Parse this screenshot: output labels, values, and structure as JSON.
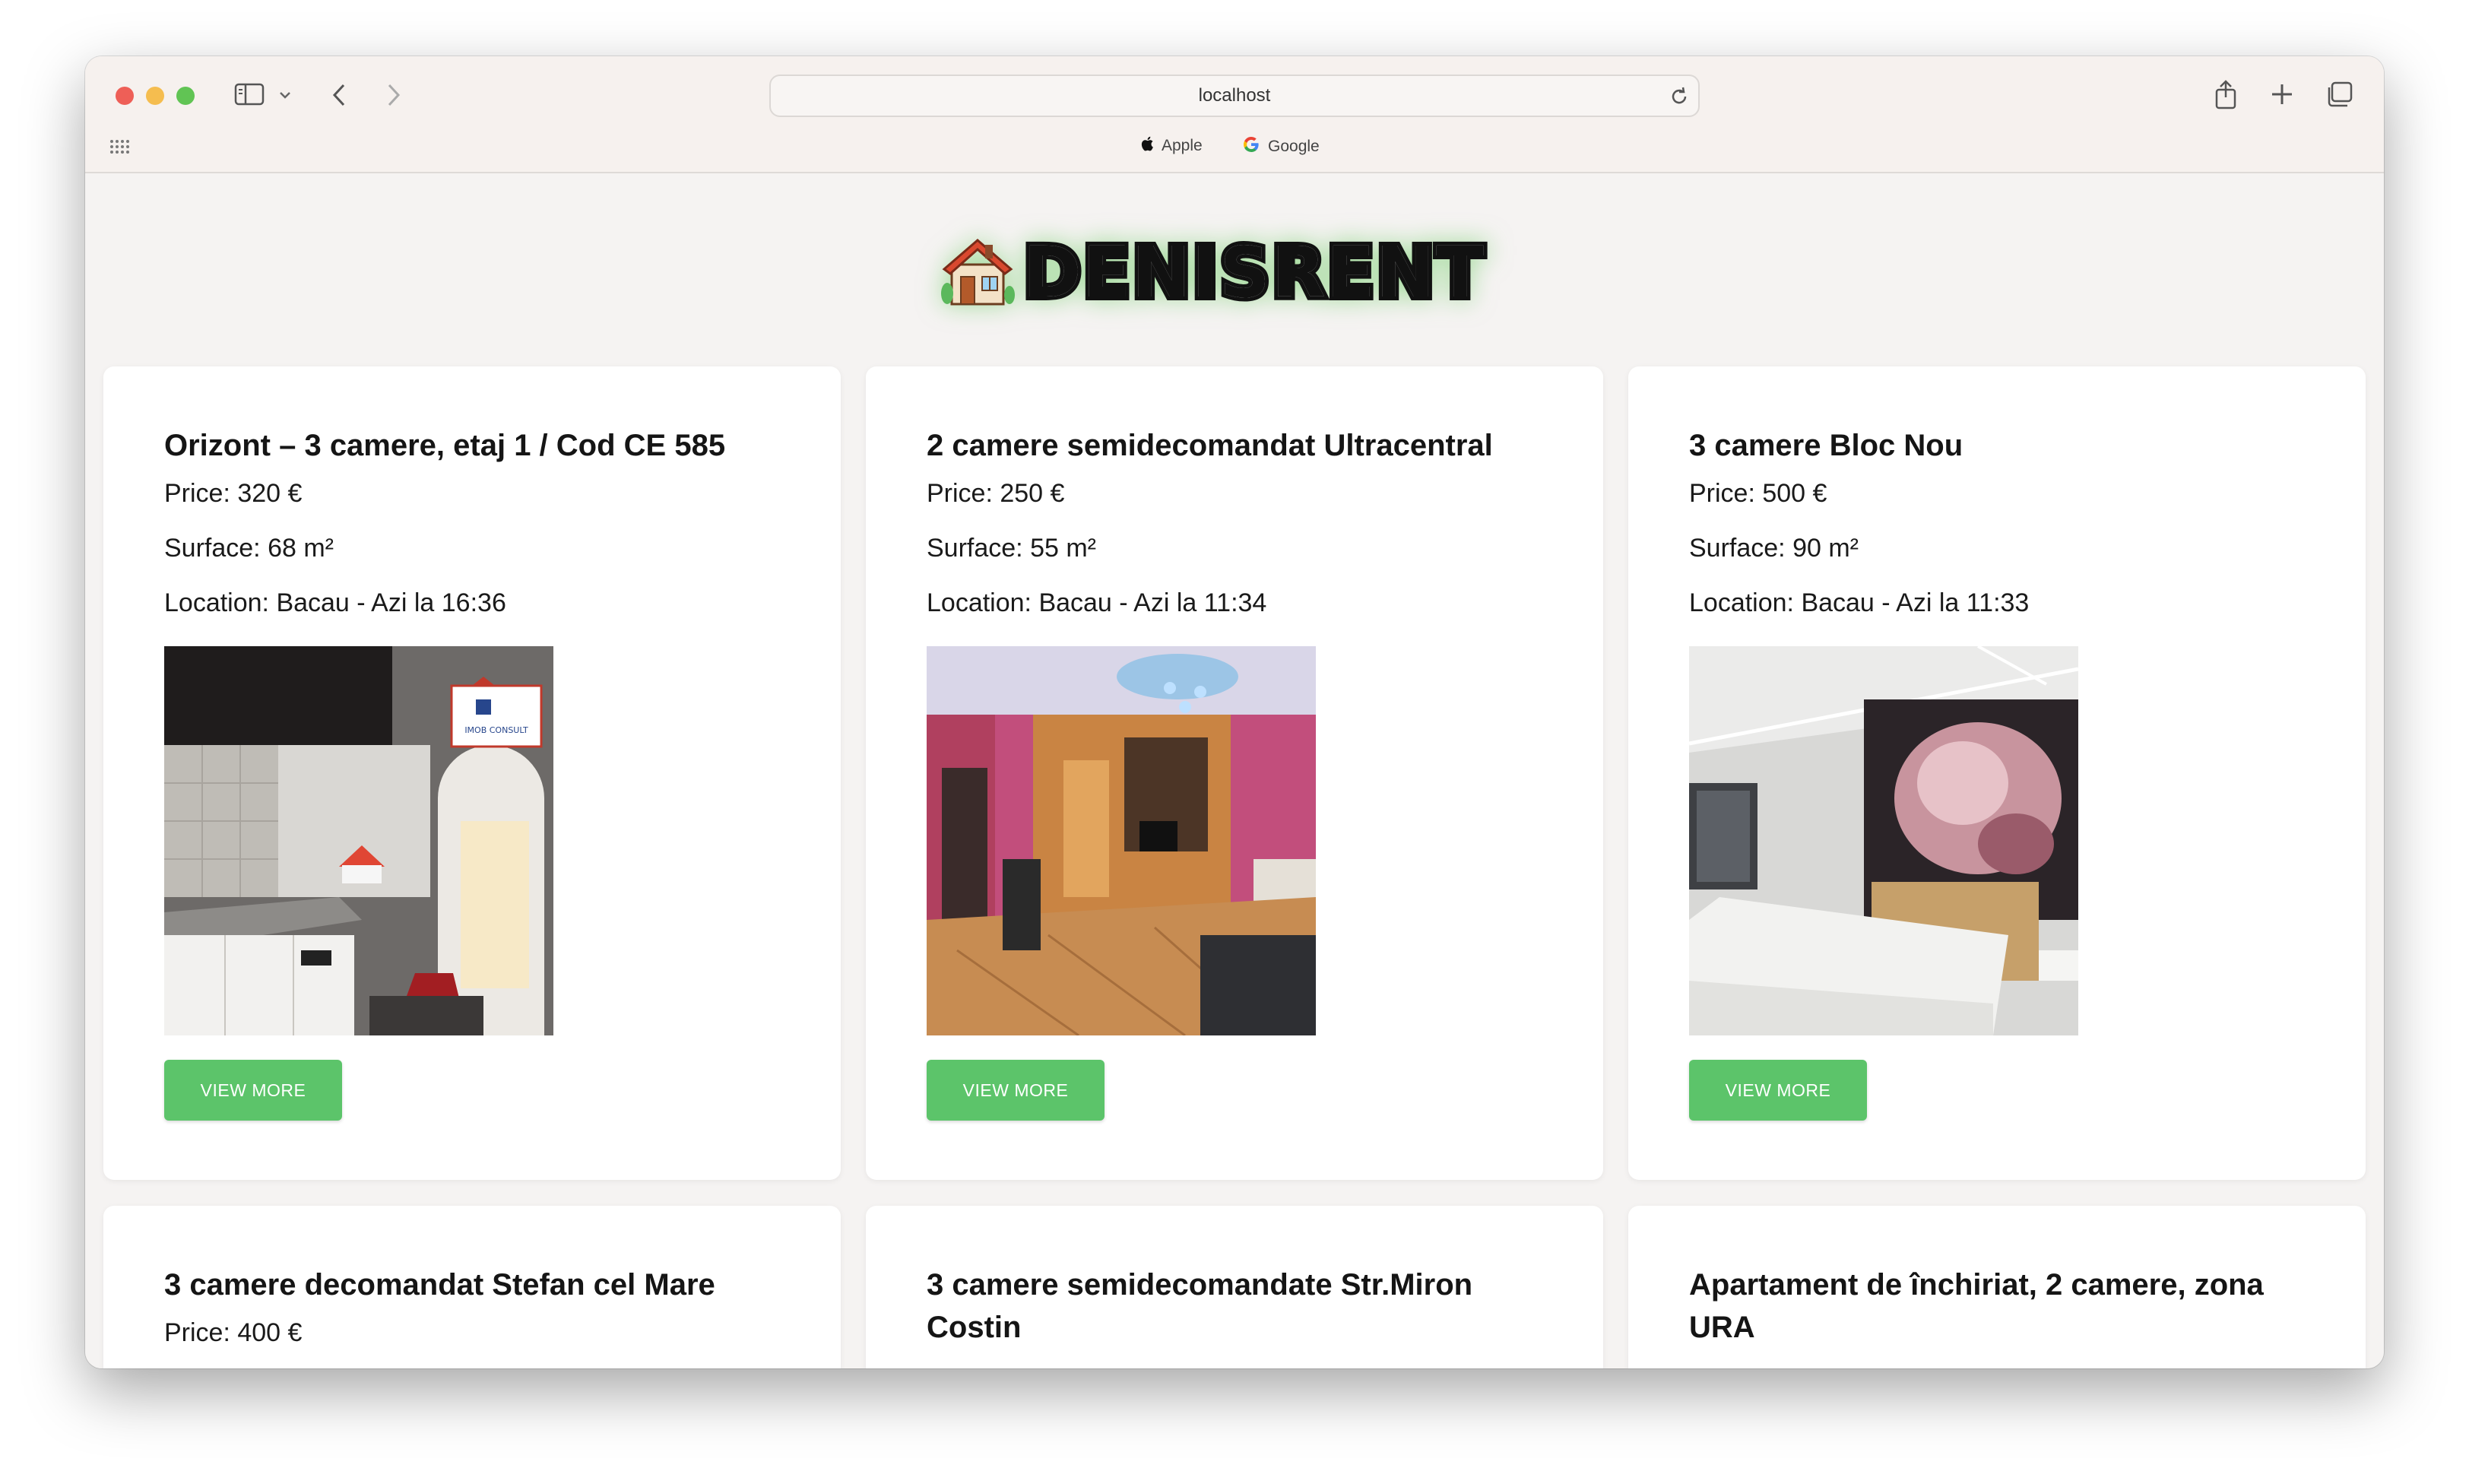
{
  "browser": {
    "url": "localhost",
    "favorites": [
      {
        "label": "Apple",
        "icon": "apple-icon"
      },
      {
        "label": "Google",
        "icon": "google-icon"
      }
    ]
  },
  "site": {
    "logo_text": "DENISRENT",
    "logo_icon": "house-icon",
    "accent_color": "#5cc46a"
  },
  "listings": [
    {
      "title": "Orizont – 3 camere, etaj 1 / Cod CE 585",
      "price": "Price: 320 €",
      "surface": "Surface: 68 m²",
      "location": "Location: Bacau - Azi la 16:36",
      "image_badge": "IMOB CONSULT",
      "button": "VIEW MORE"
    },
    {
      "title": "2 camere semidecomandat Ultracentral",
      "price": "Price: 250 €",
      "surface": "Surface: 55 m²",
      "location": "Location: Bacau - Azi la 11:34",
      "button": "VIEW MORE"
    },
    {
      "title": "3 camere Bloc Nou",
      "price": "Price: 500 €",
      "surface": "Surface: 90 m²",
      "location": "Location: Bacau - Azi la 11:33",
      "button": "VIEW MORE"
    },
    {
      "title": "3 camere decomandat Stefan cel Mare",
      "price": "Price: 400 €"
    },
    {
      "title": "3 camere semidecomandate Str.Miron Costin"
    },
    {
      "title": "Apartament de închiriat, 2 camere, zona URA"
    }
  ]
}
